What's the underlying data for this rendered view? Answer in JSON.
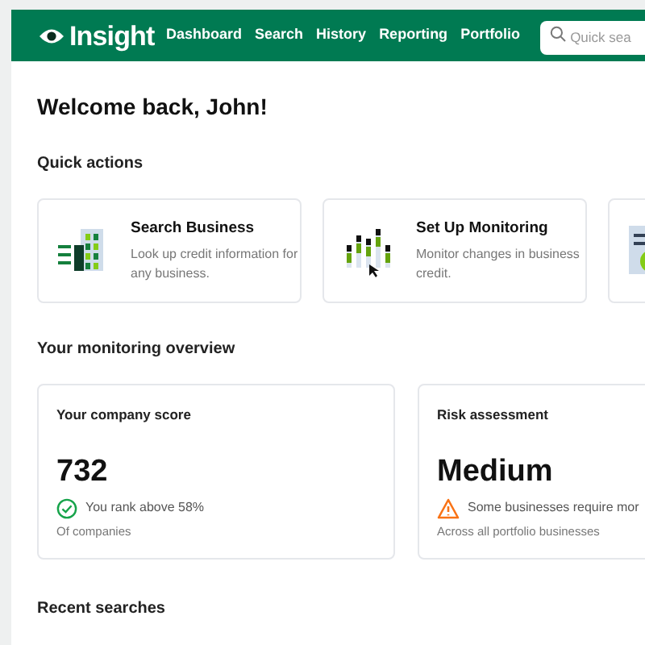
{
  "header": {
    "logo": "Insight",
    "nav": [
      {
        "label": "Dashboard"
      },
      {
        "label": "Search"
      },
      {
        "label": "History"
      },
      {
        "label": "Reporting"
      },
      {
        "label": "Portfolio"
      }
    ],
    "search": {
      "placeholder": "Quick sea"
    }
  },
  "welcome": "Welcome back, John!",
  "quick_actions": {
    "title": "Quick actions",
    "items": [
      {
        "kind": "building",
        "title": "Search Business",
        "description": "Look up credit information for any business."
      },
      {
        "kind": "chart",
        "title": "Set Up Monitoring",
        "description": "Monitor changes in business credit."
      },
      {
        "kind": "document"
      }
    ]
  },
  "monitoring": {
    "title": "Your monitoring overview",
    "cards": [
      {
        "title": "Your company score",
        "value": "732",
        "kind": "success",
        "note": "You rank above 58%",
        "caption": "Of companies"
      },
      {
        "title": "Risk assessment",
        "value": "Medium",
        "kind": "warning",
        "note": "Some businesses require mor",
        "caption": "Across all portfolio businesses"
      }
    ]
  },
  "recent": {
    "title": "Recent searches"
  }
}
